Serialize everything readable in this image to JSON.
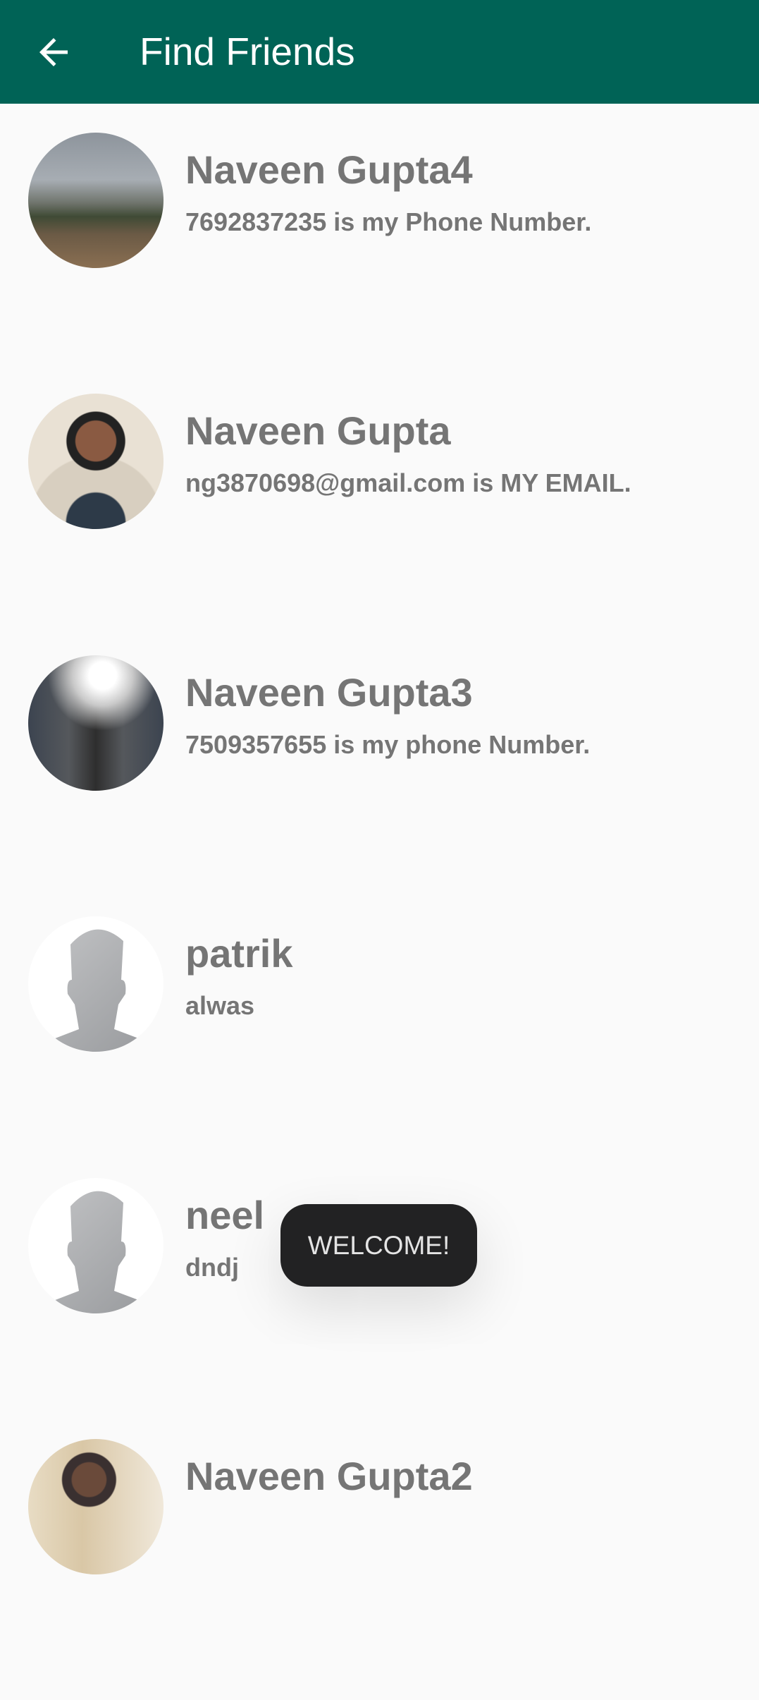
{
  "toolbar": {
    "title": "Find Friends",
    "back_icon": "arrow-back-icon",
    "color": "#006356"
  },
  "friends": [
    {
      "name": "Naveen Gupta4",
      "status": "7692837235 is my Phone Number.",
      "avatar": "landscape-photo"
    },
    {
      "name": "Naveen Gupta",
      "status": "ng3870698@gmail.com is MY EMAIL.",
      "avatar": "portrait-photo"
    },
    {
      "name": "Naveen Gupta3",
      "status": "7509357655 is my phone Number.",
      "avatar": "portrait-photo"
    },
    {
      "name": "patrik",
      "status": "alwas",
      "avatar": "default-profile"
    },
    {
      "name": "neel",
      "status": "dndj",
      "avatar": "default-profile"
    },
    {
      "name": "Naveen Gupta2",
      "status": "",
      "avatar": "portrait-photo"
    }
  ],
  "toast": {
    "text": "WELCOME!"
  }
}
